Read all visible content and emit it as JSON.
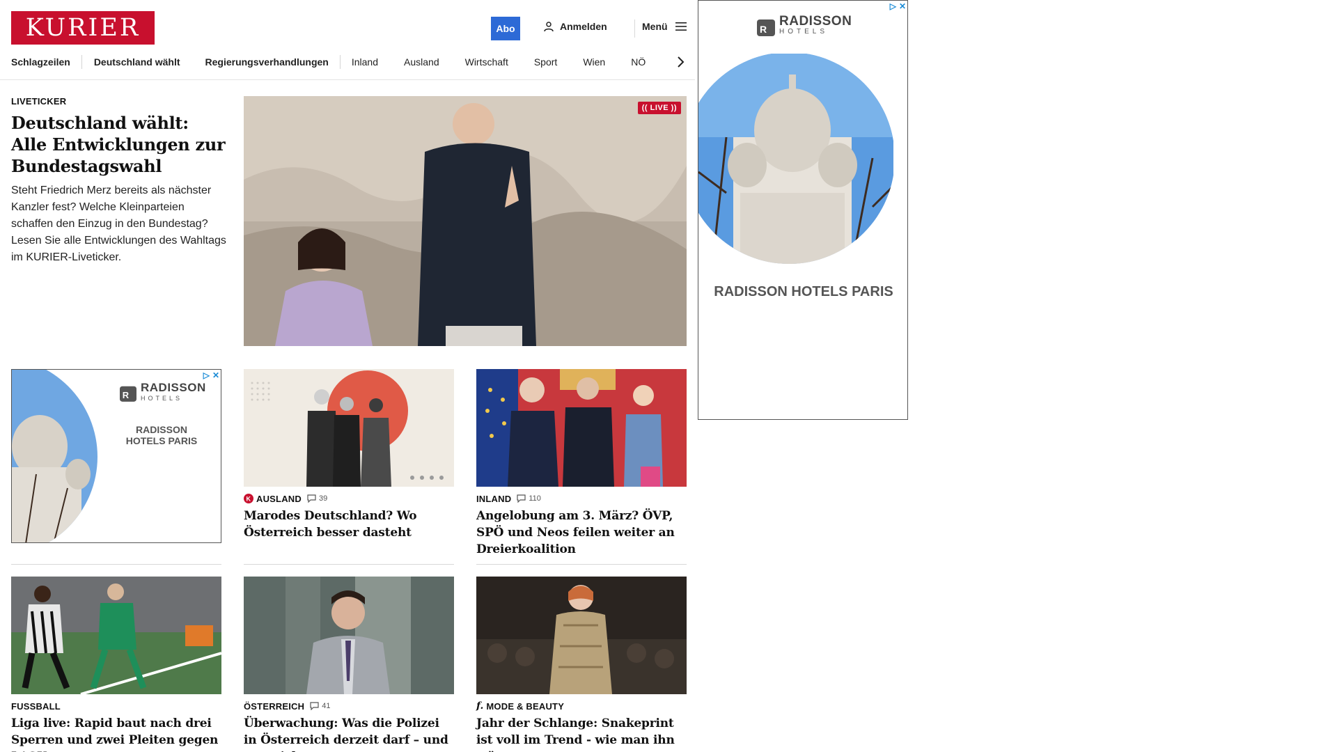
{
  "header": {
    "logo": "KURIER",
    "abo_label": "Abo",
    "login_label": "Anmelden",
    "menu_label": "Menü"
  },
  "nav": {
    "items": [
      "Schlagzeilen",
      "Deutschland wählt",
      "Regierungsverhandlungen",
      "Inland",
      "Ausland",
      "Wirtschaft",
      "Sport",
      "Wien",
      "NÖ"
    ]
  },
  "hero": {
    "kicker": "LIVETICKER",
    "title": "Deutschland wählt: Alle Entwicklungen zur Bundestagswahl",
    "lead": "Steht Friedrich Merz bereits als nächster Kanzler fest? Welche Kleinparteien schaffen den Einzug in den Bundestag? Lesen Sie alle Entwicklungen des Wahltags im KURIER-Liveticker.",
    "live_badge": "LIVE"
  },
  "ads": {
    "side": {
      "brand": "RADISSON",
      "brand_sub": "HOTELS",
      "headline": "RADISSON HOTELS PARIS"
    },
    "small": {
      "brand": "RADISSON",
      "brand_sub": "HOTELS",
      "headline": "RADISSON HOTELS PARIS"
    }
  },
  "articles": [
    {
      "kicker": "AUSLAND",
      "comments": "39",
      "title": "Marodes Deutschland? Wo Österreich besser dasteht",
      "icon": "kurier-plus-icon"
    },
    {
      "kicker": "INLAND",
      "comments": "110",
      "title": "Angelobung am 3. März? ÖVP, SPÖ und Neos feilen weiter an Dreierkoalition"
    },
    {
      "kicker": "FUSSBALL",
      "title": "Liga live: Rapid baut nach drei Sperren und zwei Pleiten gegen LASK um"
    },
    {
      "kicker": "ÖSTERREICH",
      "comments": "41",
      "title": "Überwachung: Was die Polizei in Österreich derzeit darf – und was nicht"
    },
    {
      "kicker": "MODE & BEAUTY",
      "title": "Jahr der Schlange: Snakeprint ist voll im Trend - wie man ihn trägt",
      "icon": "freizeit-icon"
    }
  ],
  "colors": {
    "brand_red": "#c8102e",
    "abo_blue": "#2d6ad6"
  }
}
